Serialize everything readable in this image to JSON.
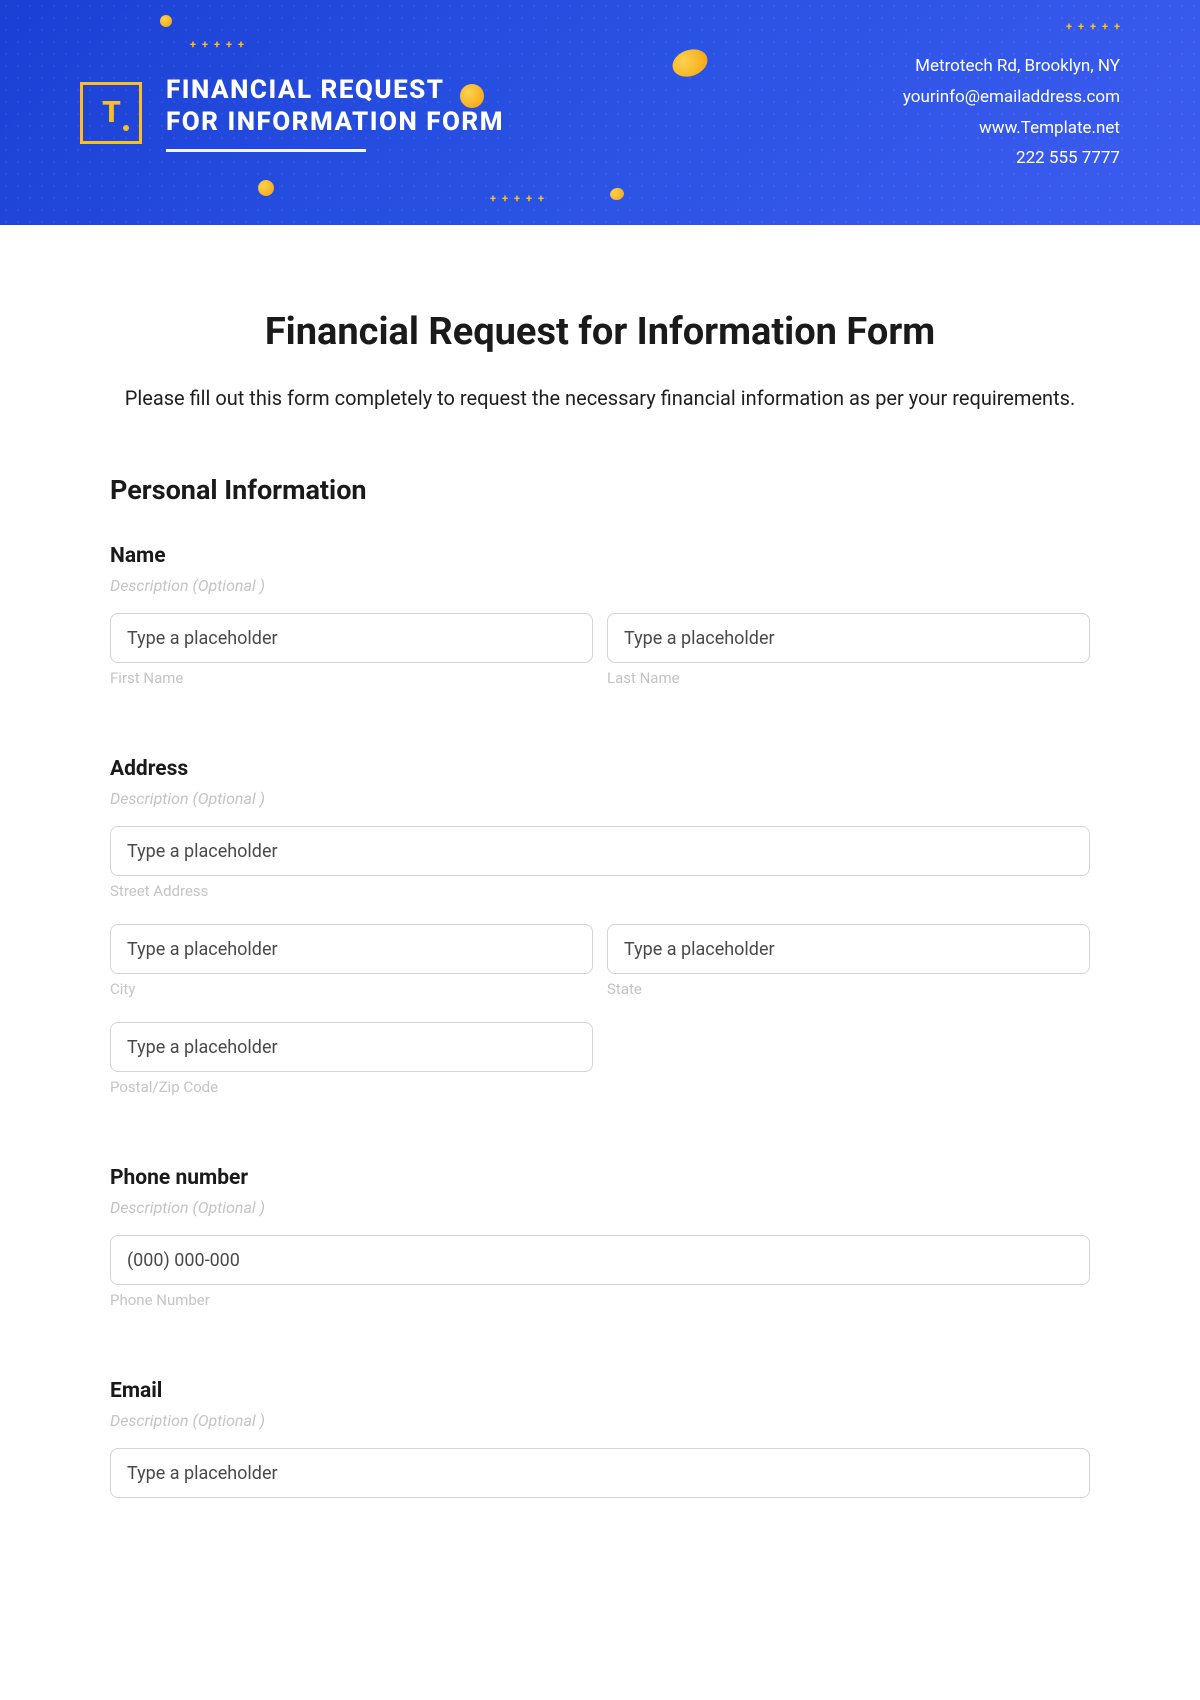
{
  "banner": {
    "logo_letter": "T",
    "title_line1": "FINANCIAL REQUEST",
    "title_line2": "FOR INFORMATION FORM",
    "contact_address": "Metrotech Rd, Brooklyn, NY",
    "contact_email": "yourinfo@emailaddress.com",
    "contact_web": "www.Template.net",
    "contact_phone": "222 555 7777"
  },
  "page": {
    "title": "Financial Request for Information Form",
    "intro": "Please fill out this form completely to request the necessary financial information as per your requirements."
  },
  "sections": {
    "personal": "Personal Information"
  },
  "fields": {
    "name": {
      "label": "Name",
      "desc": "Description  (Optional )",
      "first_placeholder": "Type a placeholder",
      "first_sub": "First Name",
      "last_placeholder": "Type a placeholder",
      "last_sub": "Last Name"
    },
    "address": {
      "label": "Address",
      "desc": "Description  (Optional )",
      "street_placeholder": "Type a placeholder",
      "street_sub": "Street Address",
      "city_placeholder": "Type a placeholder",
      "city_sub": "City",
      "state_placeholder": "Type a placeholder",
      "state_sub": "State",
      "zip_placeholder": "Type a placeholder",
      "zip_sub": "Postal/Zip Code"
    },
    "phone": {
      "label": "Phone number",
      "desc": "Description  (Optional )",
      "placeholder": "(000) 000-000",
      "sub": "Phone Number"
    },
    "email": {
      "label": "Email",
      "desc": "Description  (Optional )",
      "placeholder": "Type a placeholder"
    }
  }
}
